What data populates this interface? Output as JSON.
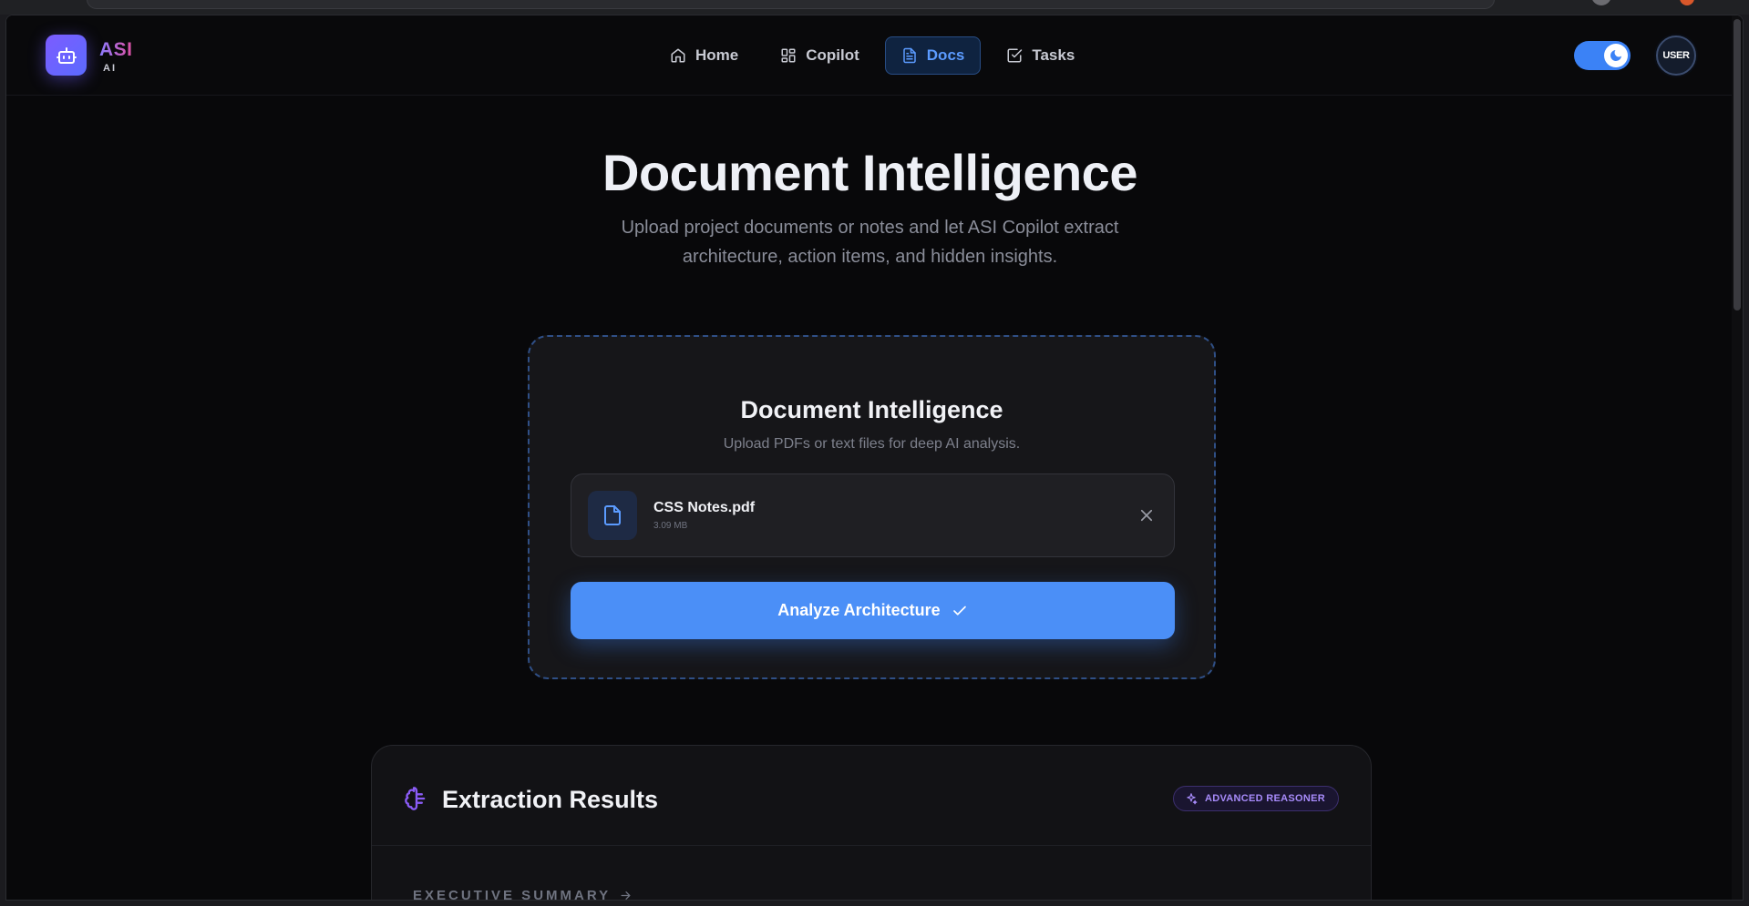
{
  "brand": {
    "name": "ASI",
    "sub": "AI"
  },
  "nav": {
    "items": [
      {
        "label": "Home",
        "icon": "home-icon",
        "active": false
      },
      {
        "label": "Copilot",
        "icon": "grid-icon",
        "active": false
      },
      {
        "label": "Docs",
        "icon": "document-icon",
        "active": true
      },
      {
        "label": "Tasks",
        "icon": "checkbox-icon",
        "active": false
      }
    ]
  },
  "theme_toggle": {
    "state": "on",
    "icon": "moon-icon"
  },
  "user": {
    "avatar_label": "USER"
  },
  "hero": {
    "title": "Document Intelligence",
    "subtitle": "Upload project documents or notes and let ASI Copilot extract architecture, action items, and hidden insights."
  },
  "upload": {
    "title": "Document Intelligence",
    "subtitle": "Upload PDFs or text files for deep AI analysis.",
    "file": {
      "name": "CSS Notes.pdf",
      "size": "3.09 MB",
      "icon": "file-icon"
    },
    "analyze_label": "Analyze Architecture"
  },
  "results": {
    "title": "Extraction Results",
    "badge": "ADVANCED REASONER",
    "section_label": "EXECUTIVE SUMMARY"
  },
  "colors": {
    "accent": "#4b8ff7",
    "badge": "#a78bfa",
    "background": "#08080a"
  }
}
